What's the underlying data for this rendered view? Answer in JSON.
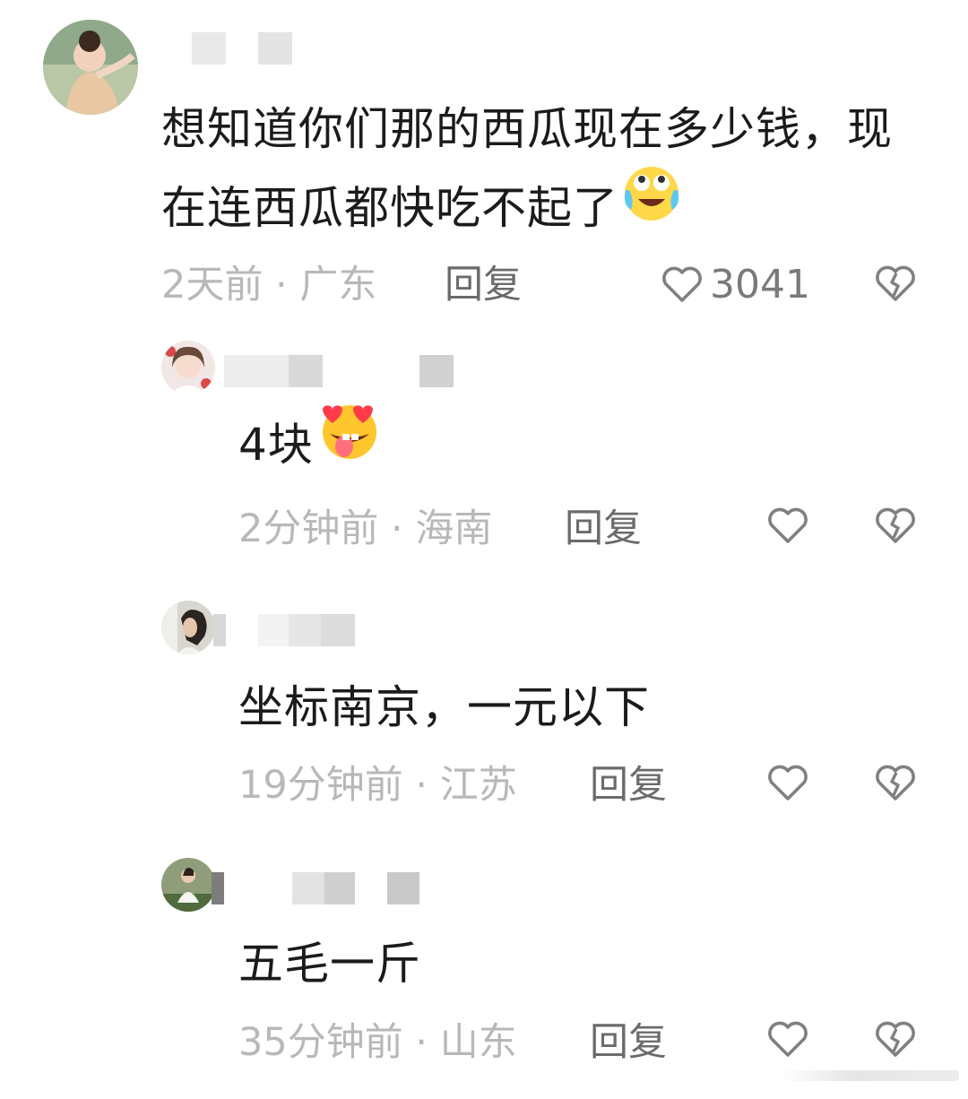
{
  "main_comment": {
    "text": "想知道你们那的西瓜现在多少钱，现在连西瓜都快吃不起了",
    "emoji": "crying-laughing-emoji",
    "time": "2天前",
    "location": "广东",
    "reply_label": "回复",
    "like_count": "3041"
  },
  "replies": [
    {
      "text": "4块",
      "emoji": "heart-eyes-tongue-emoji",
      "time": "2分钟前",
      "location": "海南",
      "reply_label": "回复"
    },
    {
      "text": "坐标南京，一元以下",
      "time": "19分钟前",
      "location": "江苏",
      "reply_label": "回复"
    },
    {
      "text": "五毛一斤",
      "time": "35分钟前",
      "location": "山东",
      "reply_label": "回复"
    }
  ],
  "separator": " · ",
  "icons": {
    "like": "heart-outline-icon",
    "dislike": "broken-heart-icon"
  },
  "colors": {
    "text": "#1b1b1b",
    "meta": "#b8b8b8",
    "reply": "#6b6b6b",
    "icon": "#808080"
  }
}
